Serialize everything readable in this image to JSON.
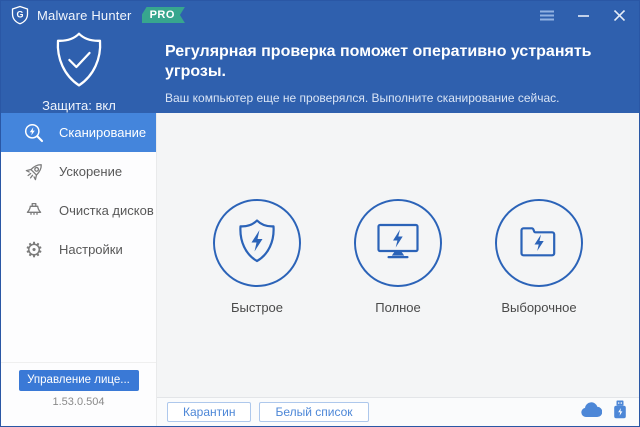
{
  "window": {
    "title": "Malware Hunter",
    "badge": "PRO",
    "logo_letter": "G"
  },
  "header": {
    "protection_status": "Защита: вкл",
    "title": "Регулярная проверка поможет оперативно устранять угрозы.",
    "subtitle": "Ваш компьютер еще не проверялся. Выполните сканирование сейчас."
  },
  "sidebar": {
    "items": [
      {
        "label": "Сканирование",
        "icon": "magnifier-bolt-icon",
        "selected": true
      },
      {
        "label": "Ускорение",
        "icon": "rocket-icon",
        "selected": false
      },
      {
        "label": "Очистка дисков",
        "icon": "broom-icon",
        "selected": false
      },
      {
        "label": "Настройки",
        "icon": "gear-icon",
        "selected": false
      }
    ],
    "gear_glyph": "⚙",
    "license_button": "Управление лице...",
    "version": "1.53.0.504"
  },
  "scan_options": [
    {
      "label": "Быстрое",
      "icon": "shield-bolt-icon"
    },
    {
      "label": "Полное",
      "icon": "monitor-bolt-icon"
    },
    {
      "label": "Выборочное",
      "icon": "folder-bolt-icon"
    }
  ],
  "footer": {
    "quarantine_button": "Карантин",
    "whitelist_button": "Белый список"
  },
  "colors": {
    "header_blue": "#2f60ae",
    "selected_item_blue": "#4485dc",
    "accent_blue": "#2b63b8",
    "icon_blue": "#4d87d7",
    "badge_green": "#37a68e",
    "license_button_blue": "#3a79d6"
  }
}
